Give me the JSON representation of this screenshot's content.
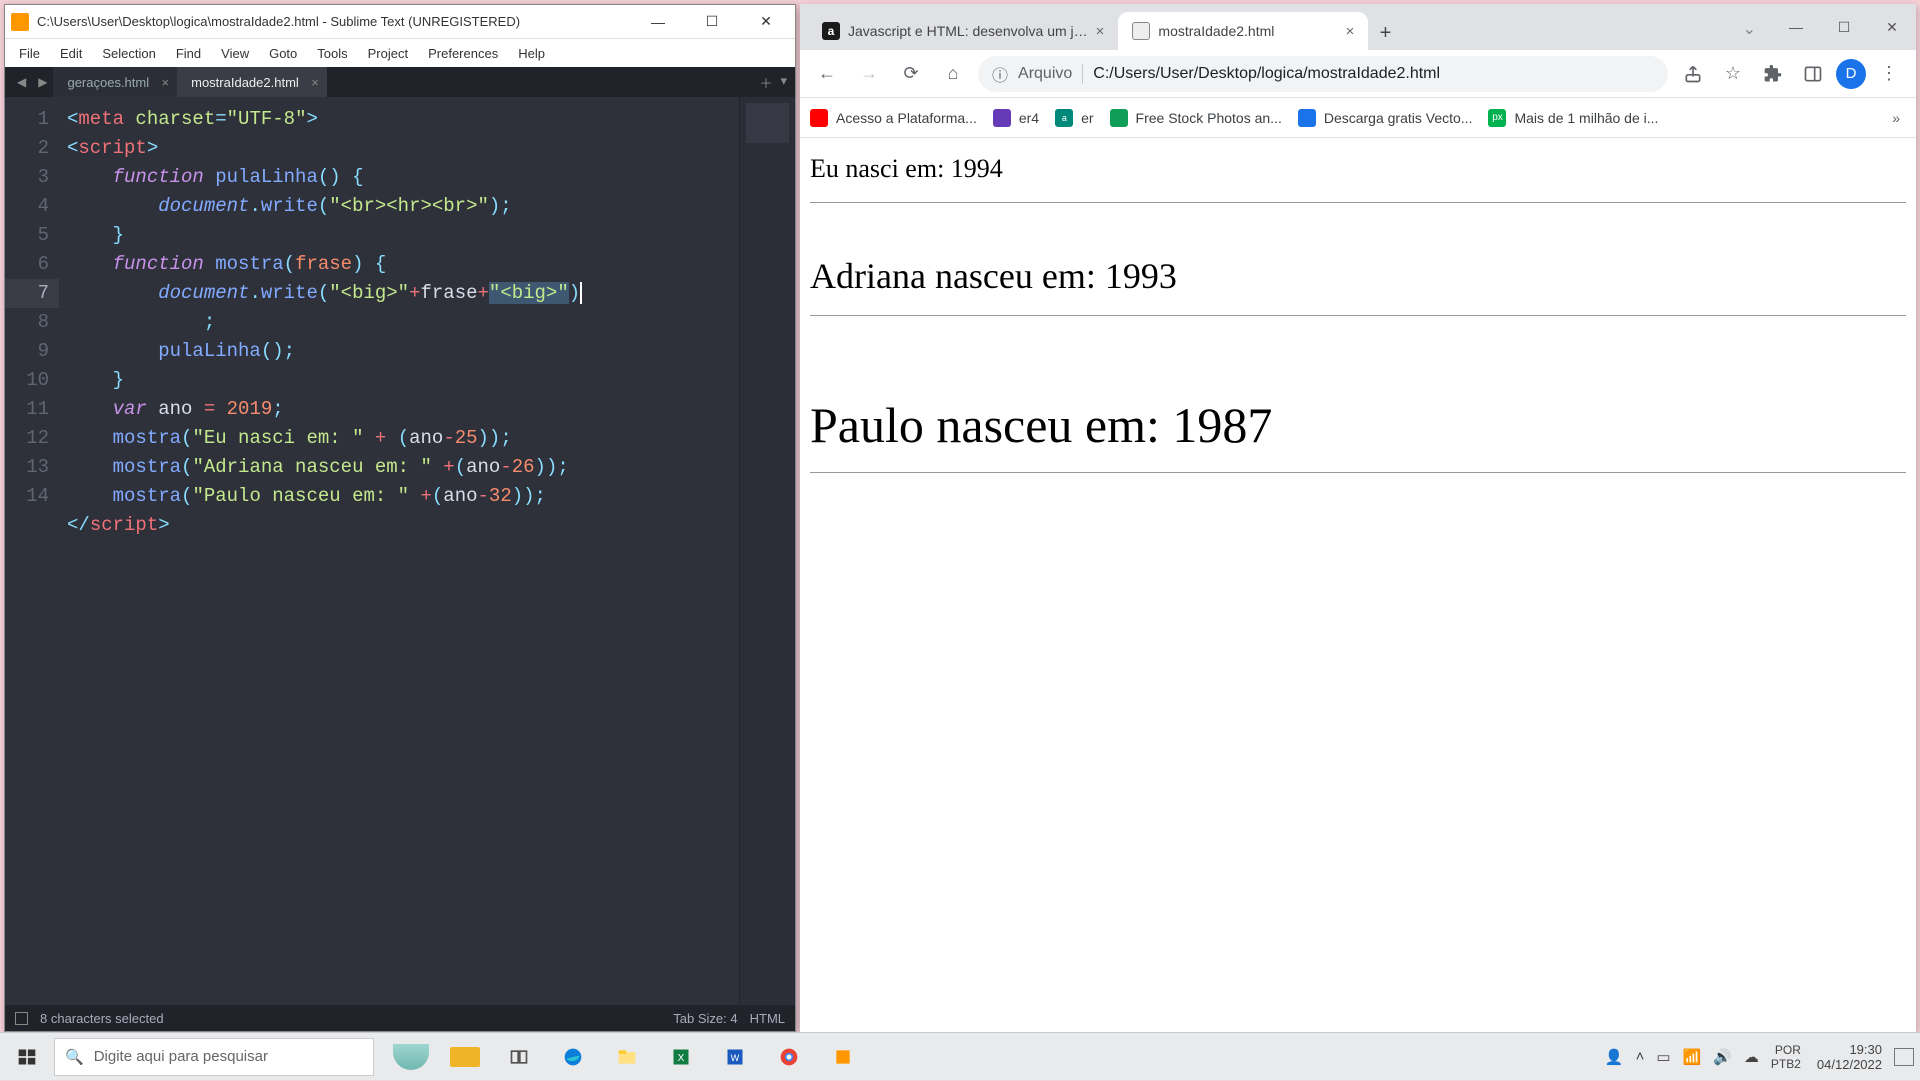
{
  "sublime": {
    "title": "C:\\Users\\User\\Desktop\\logica\\mostraIdade2.html - Sublime Text (UNREGISTERED)",
    "menu": [
      "File",
      "Edit",
      "Selection",
      "Find",
      "View",
      "Goto",
      "Tools",
      "Project",
      "Preferences",
      "Help"
    ],
    "tabs": [
      {
        "label": "geraçoes.html",
        "active": false
      },
      {
        "label": "mostraIdade2.html",
        "active": true
      }
    ],
    "gutter": [
      "1",
      "2",
      "3",
      "4",
      "5",
      "6",
      "7",
      "",
      "8",
      "9",
      "10",
      "11",
      "12",
      "13",
      "14"
    ],
    "highlight_rows": [
      6,
      7
    ],
    "status_left": "8 characters selected",
    "status_tab": "Tab Size: 4",
    "status_lang": "HTML"
  },
  "chrome": {
    "tabs": [
      {
        "label": "Javascript e HTML: desenvolva um j…",
        "active": false,
        "icon": "a"
      },
      {
        "label": "mostraIdade2.html",
        "active": true,
        "icon": "file"
      }
    ],
    "toolbar": {
      "scheme": "Arquivo",
      "url": "C:/Users/User/Desktop/logica/mostraIdade2.html"
    },
    "avatar_letter": "D",
    "bookmarks": [
      {
        "icon": "red",
        "label": "Acesso a Plataforma..."
      },
      {
        "icon": "purple",
        "label": "er4"
      },
      {
        "icon": "teal",
        "label": "er"
      },
      {
        "icon": "green",
        "label": "Free Stock Photos an..."
      },
      {
        "icon": "blue",
        "label": "Descarga gratis Vecto..."
      },
      {
        "icon": "px",
        "label": "Mais de 1 milhão de i..."
      }
    ],
    "page": {
      "line1": "Eu nasci em: 1994",
      "line2": "Adriana nasceu em: 1993",
      "line3": "Paulo nasceu em: 1987"
    }
  },
  "taskbar": {
    "search_placeholder": "Digite aqui para pesquisar",
    "lang_top": "POR",
    "lang_bot": "PTB2",
    "time": "19:30",
    "date": "04/12/2022"
  }
}
